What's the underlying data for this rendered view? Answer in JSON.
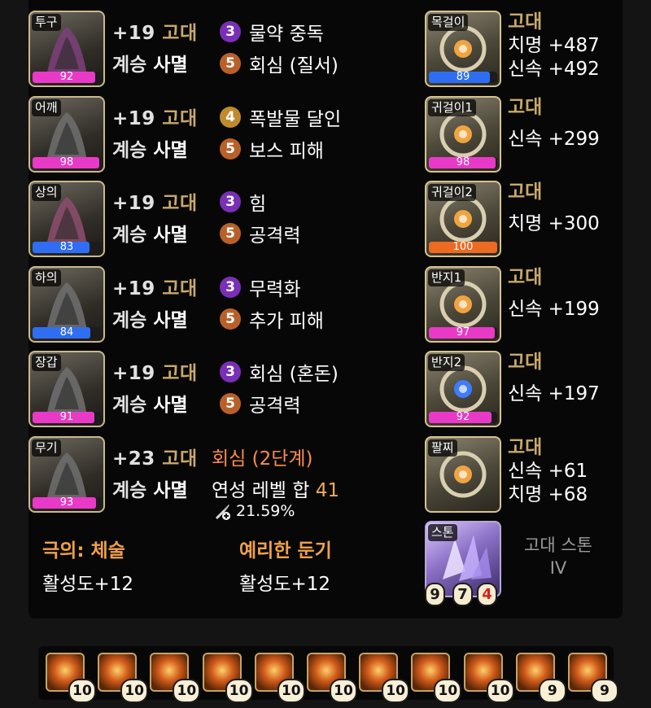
{
  "equipment": [
    {
      "slot": "투구",
      "quality": 92,
      "refine": "+19",
      "tier": "고대",
      "succession": "계승",
      "set": "사멸",
      "engravings": [
        {
          "level": "3",
          "name": "물약 중독",
          "color": "#7a2fb7"
        },
        {
          "level": "5",
          "name": "회심 (질서)",
          "color": "#b9602a"
        }
      ]
    },
    {
      "slot": "어깨",
      "quality": 98,
      "refine": "+19",
      "tier": "고대",
      "succession": "계승",
      "set": "사멸",
      "engravings": [
        {
          "level": "4",
          "name": "폭발물 달인",
          "color": "#c08a2d"
        },
        {
          "level": "5",
          "name": "보스 피해",
          "color": "#b9602a"
        }
      ]
    },
    {
      "slot": "상의",
      "quality": 83,
      "refine": "+19",
      "tier": "고대",
      "succession": "계승",
      "set": "사멸",
      "engravings": [
        {
          "level": "3",
          "name": "힘",
          "color": "#7a2fb7"
        },
        {
          "level": "5",
          "name": "공격력",
          "color": "#b9602a"
        }
      ]
    },
    {
      "slot": "하의",
      "quality": 84,
      "refine": "+19",
      "tier": "고대",
      "succession": "계승",
      "set": "사멸",
      "engravings": [
        {
          "level": "3",
          "name": "무력화",
          "color": "#7a2fb7"
        },
        {
          "level": "5",
          "name": "추가 피해",
          "color": "#b9602a"
        }
      ]
    },
    {
      "slot": "장갑",
      "quality": 91,
      "refine": "+19",
      "tier": "고대",
      "succession": "계승",
      "set": "사멸",
      "engravings": [
        {
          "level": "3",
          "name": "회심 (혼돈)",
          "color": "#7a2fb7"
        },
        {
          "level": "5",
          "name": "공격력",
          "color": "#b9602a"
        }
      ]
    },
    {
      "slot": "무기",
      "quality": 93,
      "refine": "+23",
      "tier": "고대",
      "succession": "계승",
      "set": "사멸",
      "effect": "회심 (2단계)",
      "elixir_label": "연성 레벨 합",
      "elixir_level": "41",
      "percent": "21.59%"
    }
  ],
  "accessories": [
    {
      "slot": "목걸이",
      "quality": 89,
      "tier": "고대",
      "stats": [
        "치명 +487",
        "신속 +492"
      ]
    },
    {
      "slot": "귀걸이1",
      "quality": 98,
      "tier": "고대",
      "stats": [
        "신속 +299"
      ]
    },
    {
      "slot": "귀걸이2",
      "quality": 100,
      "tier": "고대",
      "stats": [
        "치명 +300"
      ]
    },
    {
      "slot": "반지1",
      "quality": 97,
      "tier": "고대",
      "stats": [
        "신속 +199"
      ]
    },
    {
      "slot": "반지2",
      "quality": 92,
      "tier": "고대",
      "stats": [
        "신속 +197"
      ]
    },
    {
      "slot": "팔찌",
      "tier": "고대",
      "stats": [
        "신속 +61",
        "치명 +68"
      ]
    }
  ],
  "stone": {
    "slot": "스톤",
    "tier": "고대 스톤",
    "grade": "IV",
    "levels": [
      "9",
      "7",
      "4"
    ]
  },
  "abilities": [
    {
      "name": "극의: 체술",
      "value": "활성도+12"
    },
    {
      "name": "예리한 둔기",
      "value": "활성도+12"
    }
  ],
  "gems": [
    "10",
    "10",
    "10",
    "10",
    "10",
    "10",
    "10",
    "10",
    "10",
    "9",
    "9"
  ],
  "colors": {
    "quality_pink": "#e83ac6",
    "quality_blue": "#2f6ef2",
    "quality_orange": "#ec6a22",
    "tier": "#c9a96a",
    "orange_text": "#f1a148"
  }
}
